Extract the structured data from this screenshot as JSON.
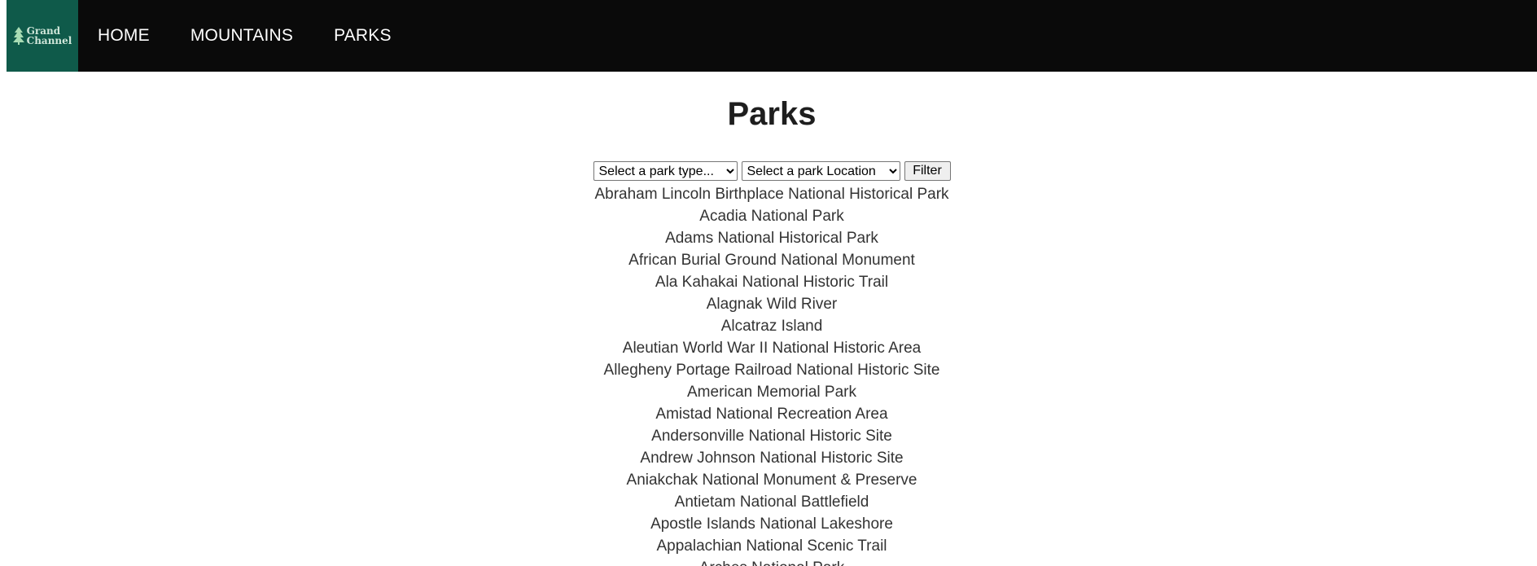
{
  "nav": {
    "logo_line1": "Grand",
    "logo_line2": "Channel",
    "links": [
      "HOME",
      "MOUNTAINS",
      "PARKS"
    ]
  },
  "page_title": "Parks",
  "filters": {
    "park_type_selected": "Select a park type...",
    "park_location_selected": "Select a park Location",
    "filter_button": "Filter"
  },
  "parks": [
    "Abraham Lincoln Birthplace National Historical Park",
    "Acadia National Park",
    "Adams National Historical Park",
    "African Burial Ground National Monument",
    "Ala Kahakai National Historic Trail",
    "Alagnak Wild River",
    "Alcatraz Island",
    "Aleutian World War II National Historic Area",
    "Allegheny Portage Railroad National Historic Site",
    "American Memorial Park",
    "Amistad National Recreation Area",
    "Andersonville National Historic Site",
    "Andrew Johnson National Historic Site",
    "Aniakchak National Monument & Preserve",
    "Antietam National Battlefield",
    "Apostle Islands National Lakeshore",
    "Appalachian National Scenic Trail",
    "Arches National Park"
  ],
  "colors": {
    "nav_background": "#0a0a0a",
    "logo_background": "#0f5a4a",
    "logo_accent": "#a8dcb4",
    "text": "#333333"
  }
}
